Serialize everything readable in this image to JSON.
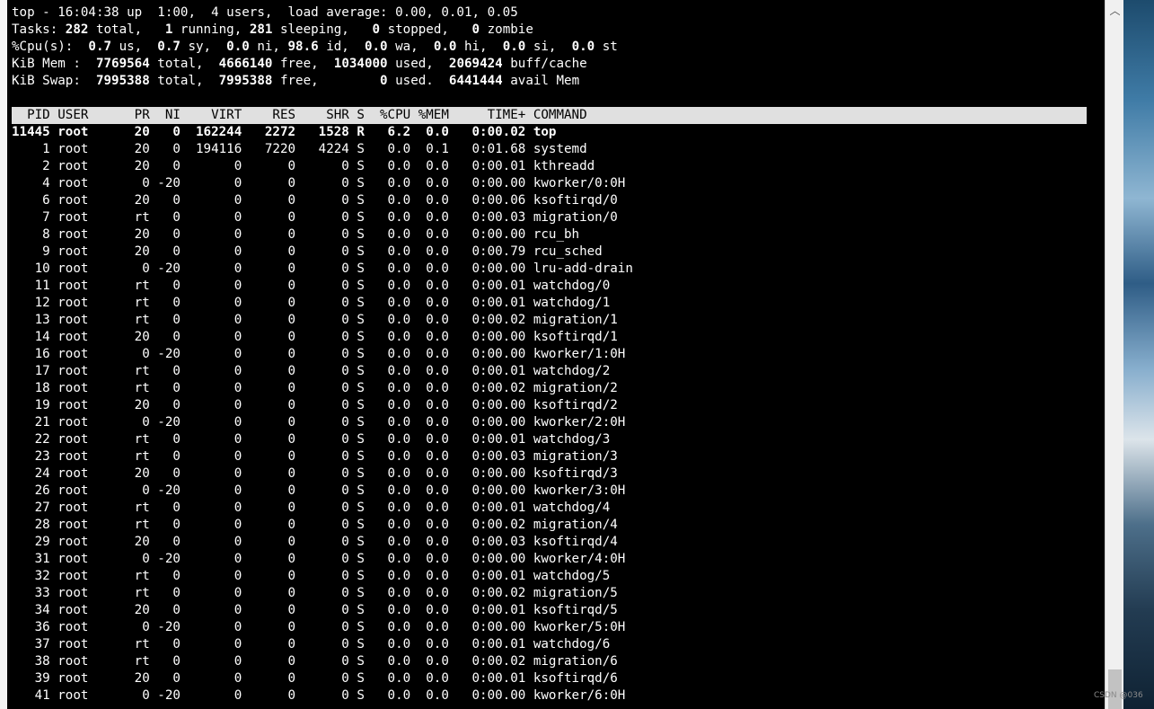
{
  "summary": {
    "uptime_line": "top - 16:04:38 up  1:00,  4 users,  load average: 0.00, 0.01, 0.05",
    "tasks": {
      "label": "Tasks: ",
      "total": "282",
      "total_label": " total,   ",
      "running": "1",
      "running_label": " running, ",
      "sleeping": "281",
      "sleeping_label": " sleeping,   ",
      "stopped": "0",
      "stopped_label": " stopped,   ",
      "zombie": "0",
      "zombie_label": " zombie"
    },
    "cpu": {
      "label": "%Cpu(s):  ",
      "us": "0.7",
      "us_label": " us,  ",
      "sy": "0.7",
      "sy_label": " sy,  ",
      "ni": "0.0",
      "ni_label": " ni, ",
      "id": "98.6",
      "id_label": " id,  ",
      "wa": "0.0",
      "wa_label": " wa,  ",
      "hi": "0.0",
      "hi_label": " hi,  ",
      "si": "0.0",
      "si_label": " si,  ",
      "st": "0.0",
      "st_label": " st"
    },
    "mem": {
      "label": "KiB Mem :  ",
      "total": "7769564",
      "total_label": " total,  ",
      "free": "4666140",
      "free_label": " free,  ",
      "used": "1034000",
      "used_label": " used,  ",
      "buff": "2069424",
      "buff_label": " buff/cache"
    },
    "swap": {
      "label": "KiB Swap:  ",
      "total": "7995388",
      "total_label": " total,  ",
      "free": "7995388",
      "free_label": " free,        ",
      "used": "0",
      "used_label": " used.  ",
      "avail": "6441444",
      "avail_label": " avail Mem"
    }
  },
  "header": "  PID USER      PR  NI    VIRT    RES    SHR S  %CPU %MEM     TIME+ COMMAND",
  "rows": [
    "11445 root      20   0  162244   2272   1528 R   6.2  0.0   0:00.02 top",
    "    1 root      20   0  194116   7220   4224 S   0.0  0.1   0:01.68 systemd",
    "    2 root      20   0       0      0      0 S   0.0  0.0   0:00.01 kthreadd",
    "    4 root       0 -20       0      0      0 S   0.0  0.0   0:00.00 kworker/0:0H",
    "    6 root      20   0       0      0      0 S   0.0  0.0   0:00.06 ksoftirqd/0",
    "    7 root      rt   0       0      0      0 S   0.0  0.0   0:00.03 migration/0",
    "    8 root      20   0       0      0      0 S   0.0  0.0   0:00.00 rcu_bh",
    "    9 root      20   0       0      0      0 S   0.0  0.0   0:00.79 rcu_sched",
    "   10 root       0 -20       0      0      0 S   0.0  0.0   0:00.00 lru-add-drain",
    "   11 root      rt   0       0      0      0 S   0.0  0.0   0:00.01 watchdog/0",
    "   12 root      rt   0       0      0      0 S   0.0  0.0   0:00.01 watchdog/1",
    "   13 root      rt   0       0      0      0 S   0.0  0.0   0:00.02 migration/1",
    "   14 root      20   0       0      0      0 S   0.0  0.0   0:00.00 ksoftirqd/1",
    "   16 root       0 -20       0      0      0 S   0.0  0.0   0:00.00 kworker/1:0H",
    "   17 root      rt   0       0      0      0 S   0.0  0.0   0:00.01 watchdog/2",
    "   18 root      rt   0       0      0      0 S   0.0  0.0   0:00.02 migration/2",
    "   19 root      20   0       0      0      0 S   0.0  0.0   0:00.00 ksoftirqd/2",
    "   21 root       0 -20       0      0      0 S   0.0  0.0   0:00.00 kworker/2:0H",
    "   22 root      rt   0       0      0      0 S   0.0  0.0   0:00.01 watchdog/3",
    "   23 root      rt   0       0      0      0 S   0.0  0.0   0:00.03 migration/3",
    "   24 root      20   0       0      0      0 S   0.0  0.0   0:00.00 ksoftirqd/3",
    "   26 root       0 -20       0      0      0 S   0.0  0.0   0:00.00 kworker/3:0H",
    "   27 root      rt   0       0      0      0 S   0.0  0.0   0:00.01 watchdog/4",
    "   28 root      rt   0       0      0      0 S   0.0  0.0   0:00.02 migration/4",
    "   29 root      20   0       0      0      0 S   0.0  0.0   0:00.03 ksoftirqd/4",
    "   31 root       0 -20       0      0      0 S   0.0  0.0   0:00.00 kworker/4:0H",
    "   32 root      rt   0       0      0      0 S   0.0  0.0   0:00.01 watchdog/5",
    "   33 root      rt   0       0      0      0 S   0.0  0.0   0:00.02 migration/5",
    "   34 root      20   0       0      0      0 S   0.0  0.0   0:00.01 ksoftirqd/5",
    "   36 root       0 -20       0      0      0 S   0.0  0.0   0:00.00 kworker/5:0H",
    "   37 root      rt   0       0      0      0 S   0.0  0.0   0:00.01 watchdog/6",
    "   38 root      rt   0       0      0      0 S   0.0  0.0   0:00.02 migration/6",
    "   39 root      20   0       0      0      0 S   0.0  0.0   0:00.01 ksoftirqd/6",
    "   41 root       0 -20       0      0      0 S   0.0  0.0   0:00.00 kworker/6:0H"
  ],
  "scrollbar": {
    "up_arrow_icon": "chevron-up-icon",
    "up_glyph": "︿"
  },
  "watermark": "CSDN @036"
}
